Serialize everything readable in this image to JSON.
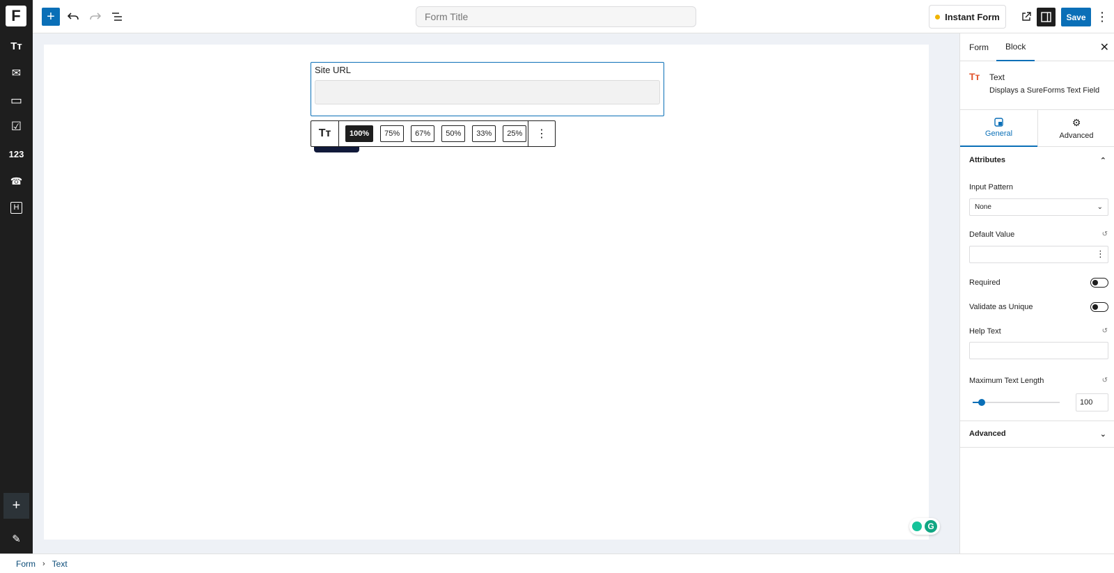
{
  "app": {
    "logo": "F"
  },
  "left_rail": {
    "items": [
      {
        "name": "text-icon",
        "glyph": "Tт"
      },
      {
        "name": "email-icon",
        "glyph": "✉"
      },
      {
        "name": "textarea-icon",
        "glyph": "▭"
      },
      {
        "name": "checkbox-icon",
        "glyph": "☑"
      },
      {
        "name": "number-icon",
        "glyph": "123"
      },
      {
        "name": "phone-icon",
        "glyph": "☎"
      },
      {
        "name": "heading-icon",
        "glyph": "H"
      }
    ],
    "add_glyph": "+",
    "edit_glyph": "✎"
  },
  "topbar": {
    "title_placeholder": "Form Title",
    "instant_form_label": "Instant Form",
    "save_label": "Save"
  },
  "canvas": {
    "field_label": "Site URL",
    "width_options": [
      "100%",
      "75%",
      "67%",
      "50%",
      "33%",
      "25%"
    ],
    "active_width": "100%"
  },
  "inspector": {
    "tabs": [
      "Form",
      "Block"
    ],
    "active_tab": "Block",
    "block_title": "Text",
    "block_description": "Displays a SureForms Text Field",
    "sub_tabs": [
      "General",
      "Advanced"
    ],
    "active_sub_tab": "General",
    "attributes_heading": "Attributes",
    "input_pattern_label": "Input Pattern",
    "input_pattern_value": "None",
    "default_value_label": "Default Value",
    "required_label": "Required",
    "required_on": false,
    "unique_label": "Validate as Unique",
    "unique_on": false,
    "help_text_label": "Help Text",
    "max_length_label": "Maximum Text Length",
    "max_length_value": "100",
    "max_length_fraction": 0.1,
    "advanced_heading": "Advanced"
  },
  "breadcrumb": [
    "Form",
    "Text"
  ],
  "colors": {
    "accent": "#0a6fb7",
    "sidebar": "#1e1e1e",
    "canvas_bg": "#eef1f6",
    "block_icon": "#e2542d",
    "instant_dot": "#f0b400"
  }
}
